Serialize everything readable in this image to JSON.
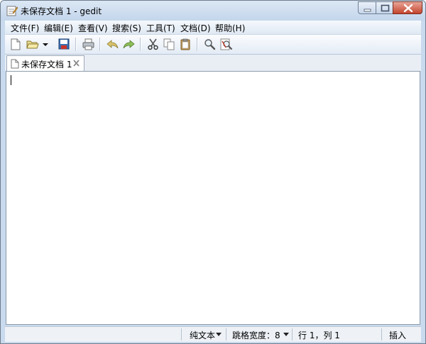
{
  "window": {
    "title": "未保存文档 1 - gedit"
  },
  "menu": {
    "file": "文件(F)",
    "edit": "编辑(E)",
    "view": "查看(V)",
    "search": "搜索(S)",
    "tools": "工具(T)",
    "documents": "文档(D)",
    "help": "帮助(H)"
  },
  "toolbar": {
    "icons": [
      "new-document-icon",
      "open-folder-icon",
      "dropdown-arrow-icon",
      "save-icon",
      "print-icon",
      "undo-icon",
      "redo-icon",
      "cut-icon",
      "copy-icon",
      "paste-icon",
      "find-icon",
      "replace-icon"
    ]
  },
  "tab": {
    "label": "未保存文档 1"
  },
  "statusbar": {
    "language": "纯文本",
    "tab_width": "跳格宽度：8",
    "position": "行 1，列 1",
    "mode": "插入"
  },
  "colors": {
    "title_bar": "#c4d6ec",
    "close_button": "#c4452e",
    "editor_bg": "#ffffff"
  }
}
